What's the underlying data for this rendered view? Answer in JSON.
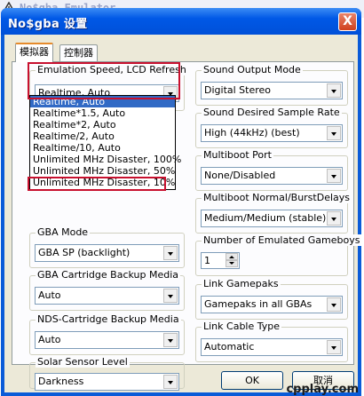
{
  "background_window": {
    "title": "No$gba Emulator"
  },
  "dialog": {
    "title": "No$gba 设置",
    "close_label": "X"
  },
  "tabs": [
    {
      "label": "模拟器",
      "active": true
    },
    {
      "label": "控制器",
      "active": false
    }
  ],
  "left": {
    "emulation_speed": {
      "label": "Emulation Speed, LCD Refresh",
      "value": "Realtime, Auto"
    },
    "gba_mode": {
      "label": "GBA Mode",
      "value": "GBA SP (backlight)"
    },
    "gba_backup": {
      "label": "GBA Cartridge Backup Media",
      "value": "Auto"
    },
    "nds_backup": {
      "label": "NDS-Cartridge Backup Media",
      "value": "Auto"
    },
    "solar_sensor": {
      "label": "Solar Sensor Level",
      "value": "Darkness"
    }
  },
  "right": {
    "sound_output": {
      "label": "Sound Output Mode",
      "value": "Digital Stereo"
    },
    "sample_rate": {
      "label": "Sound Desired Sample Rate",
      "value": "High (44kHz) (best)"
    },
    "multiboot_port": {
      "label": "Multiboot Port",
      "value": "None/Disabled"
    },
    "multiboot_delays": {
      "label": "Multiboot Normal/BurstDelays",
      "value": "Medium/Medium (stable)"
    },
    "gameboys": {
      "label": "Number of Emulated Gameboys",
      "value": "1"
    },
    "link_gamepaks": {
      "label": "Link Gamepaks",
      "value": "Gamepaks in all GBAs"
    },
    "link_cable": {
      "label": "Link Cable Type",
      "value": "Automatic"
    }
  },
  "speed_options": [
    "Realtime, Auto",
    "Realtime*1.5, Auto",
    "Realtime*2, Auto",
    "Realtime/2, Auto",
    "Realtime/10, Auto",
    "Unlimited MHz Disaster, 100%",
    "Unlimited MHz Disaster, 50%",
    "Unlimited MHz Disaster, 10%"
  ],
  "buttons": {
    "ok": "OK",
    "cancel": "取消"
  },
  "watermark": "cpplay.com",
  "colors": {
    "highlight_box": "#c8102e",
    "selection": "#316ac5",
    "title_bar": "#0058e6"
  }
}
